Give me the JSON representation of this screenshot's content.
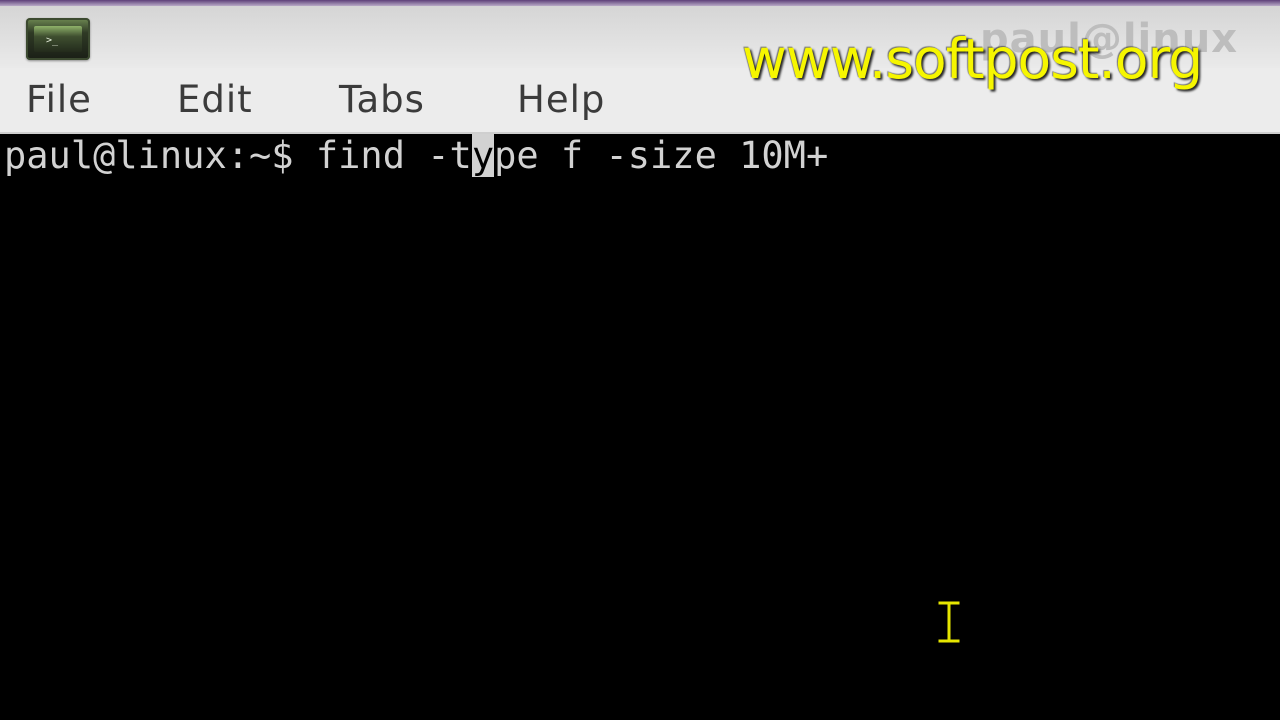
{
  "window": {
    "title": "paul@linux",
    "watermark": "www.softpost.org"
  },
  "icons": {
    "app": "terminal-app-icon",
    "pointer": "ibeam-cursor-icon"
  },
  "menu": {
    "items": [
      {
        "label": "File"
      },
      {
        "label": "Edit"
      },
      {
        "label": "Tabs"
      },
      {
        "label": "Help"
      }
    ]
  },
  "terminal": {
    "prompt": "paul@linux:~$ ",
    "command_before_cursor": "find -t",
    "cursor_char": "y",
    "command_after_cursor": "pe f -size 10M+"
  },
  "colors": {
    "watermark": "#f6f600",
    "terminal_bg": "#000000",
    "terminal_fg": "#d2d2d2",
    "menu_bg": "#ececec"
  }
}
